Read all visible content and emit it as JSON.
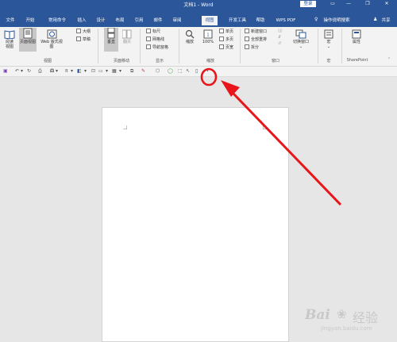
{
  "window": {
    "title": "文档1 - Word",
    "login": "登录",
    "min": "—",
    "restore": "❐",
    "close": "✕"
  },
  "tabs": [
    "文件",
    "开始",
    "常用命令",
    "插入",
    "设计",
    "布局",
    "引用",
    "邮件",
    "审阅",
    "视图",
    "开发工具",
    "帮助",
    "WPS PDF",
    "操作说明搜索",
    "共享"
  ],
  "active_tab": "视图",
  "ribbon": {
    "views": {
      "read": "阅读视图",
      "print": "页面视图",
      "web": "Web 版式视图",
      "outline": "大纲",
      "draft": "草稿",
      "group": "视图"
    },
    "page_move": {
      "vertical": "垂直",
      "side": "翻页",
      "group": "页面移动"
    },
    "show": {
      "ruler": "标尺",
      "grid": "网格线",
      "nav": "导航窗格",
      "group": "显示"
    },
    "zoom": {
      "zoom": "缩放",
      "hundred": "100%",
      "one": "单页",
      "multi": "多页",
      "width": "页宽",
      "group": "缩放"
    },
    "window": {
      "new": "新建窗口",
      "arrange": "全部重排",
      "split": "拆分",
      "switch": "切换窗口",
      "group": "窗口"
    },
    "macro": {
      "label": "宏",
      "group": "宏"
    },
    "sharepoint": {
      "label": "属性",
      "group": "SharePoint"
    }
  },
  "watermark": {
    "brand": "Bai",
    "suffix": "经验",
    "url": "jingyan.baidu.com"
  },
  "colors": {
    "accent": "#2b579a",
    "annotation": "#e8161b"
  }
}
